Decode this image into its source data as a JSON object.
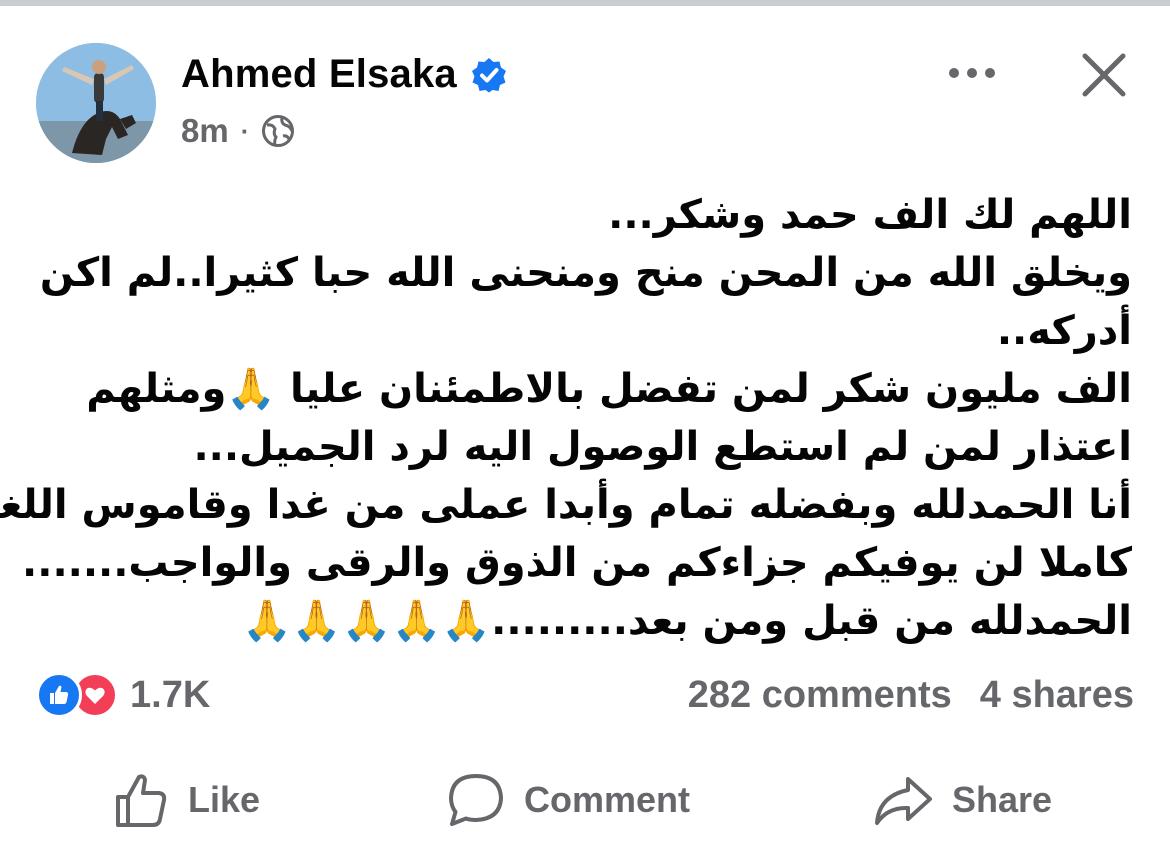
{
  "post": {
    "author": "Ahmed Elsaka",
    "verified_icon": "verified-badge-icon",
    "time": "8m",
    "separator": "·",
    "privacy_icon": "globe-icon",
    "text_lines": [
      "اللهم لك الف حمد وشكر...",
      "ويخلق الله من المحن منح ومنحنى الله حبا كثيرا..لم اكن",
      "أدركه..",
      "الف مليون شكر لمن تفضل بالاطمئنان عليا 🙏ومثلهم",
      "اعتذار لمن لم استطع الوصول اليه لرد الجميل...",
      "أنا الحمدلله وبفضله تمام وأبدا عملى من غدا وقاموس اللغه",
      "كاملا لن يوفيكم جزاءكم من الذوق والرقى والواجب.......",
      "الحمدلله من قبل ومن بعد.........🙏🙏🙏🙏🙏"
    ]
  },
  "header_actions": {
    "more_icon": "more-options-icon",
    "close_icon": "close-icon"
  },
  "stats": {
    "reactions_count": "1.7K",
    "comments": "282 comments",
    "shares": "4 shares",
    "reaction_icons": [
      "like-reaction-icon",
      "love-reaction-icon"
    ],
    "like_color": "#1877f2",
    "love_color": "#f33e58"
  },
  "actions": {
    "like": "Like",
    "comment": "Comment",
    "share": "Share"
  },
  "colors": {
    "verified": "#1877f2",
    "secondary_text": "#65676b",
    "primary_text": "#050505"
  }
}
